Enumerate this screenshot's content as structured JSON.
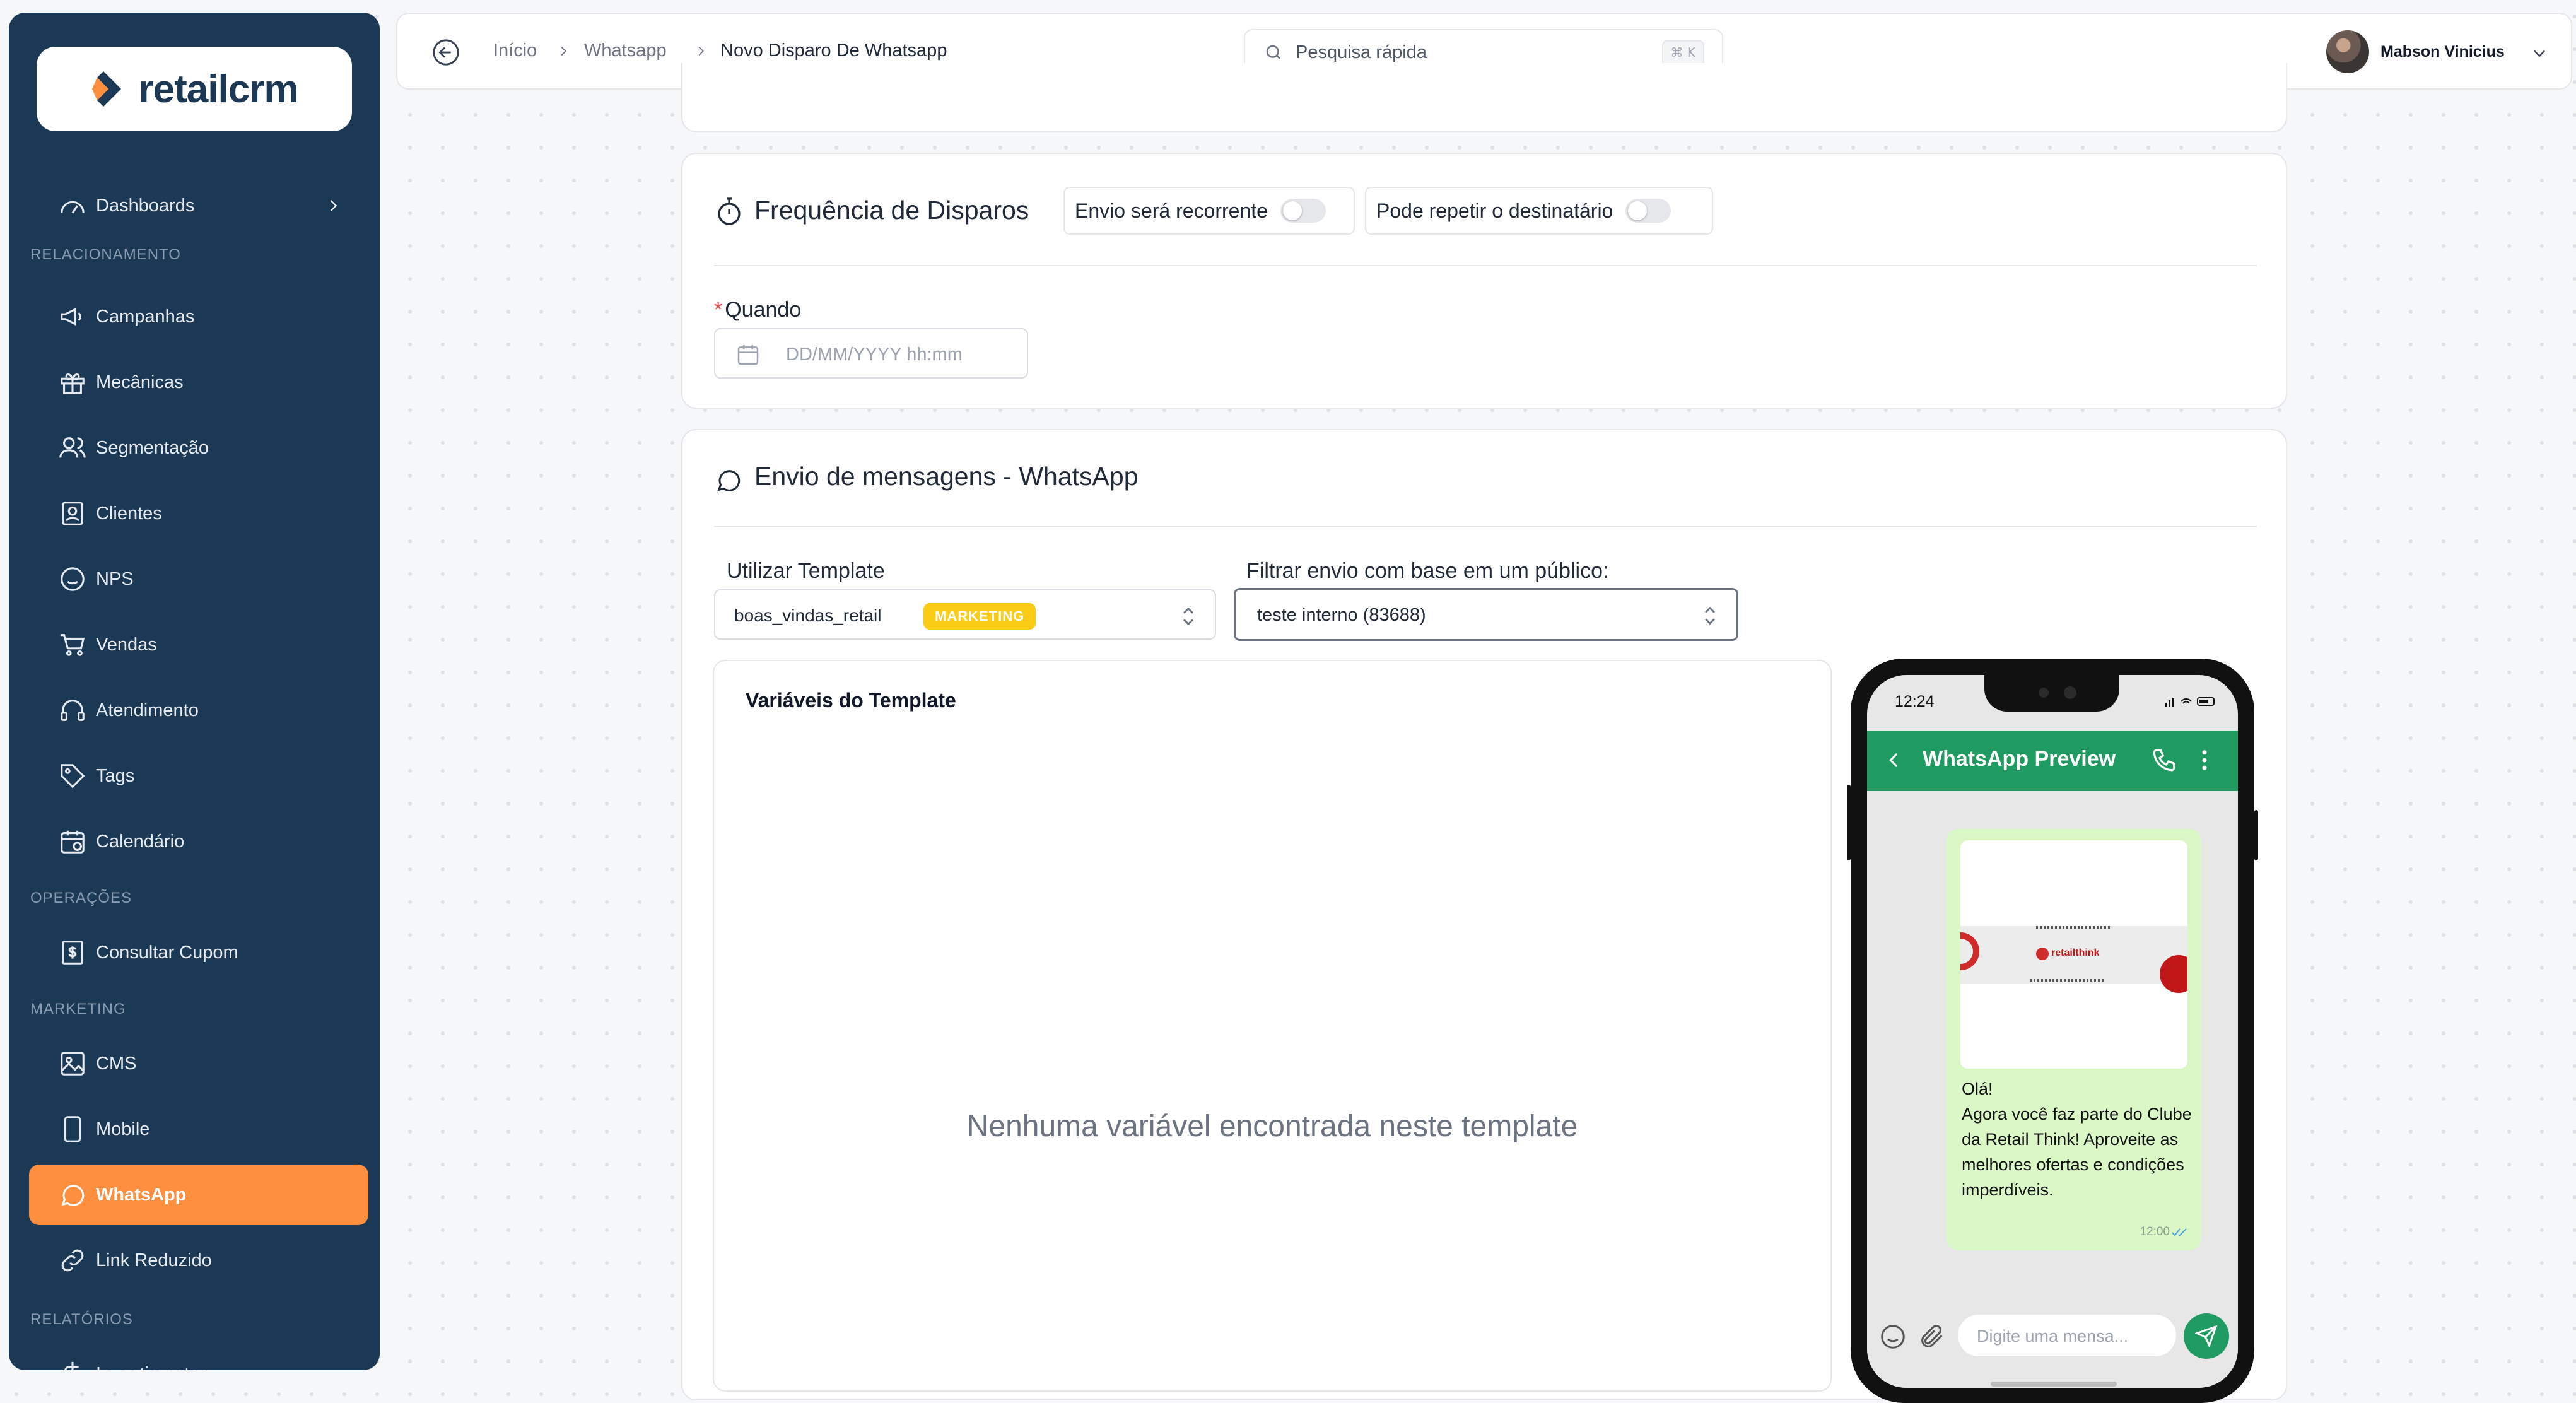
{
  "sidebar": {
    "logo_text": "retailcrm",
    "sections": {
      "relacionamento": "RELACIONAMENTO",
      "operacoes": "OPERAÇÕES",
      "marketing": "MARKETING",
      "relatorios": "RELATÓRIOS"
    },
    "items": {
      "dashboards": "Dashboards",
      "campanhas": "Campanhas",
      "mecanicas": "Mecânicas",
      "segmentacao": "Segmentação",
      "clientes": "Clientes",
      "nps": "NPS",
      "vendas": "Vendas",
      "atendimento": "Atendimento",
      "tags": "Tags",
      "calendario": "Calendário",
      "consultar_cupom": "Consultar Cupom",
      "cms": "CMS",
      "mobile": "Mobile",
      "whatsapp": "WhatsApp",
      "link_reduzido": "Link Reduzido",
      "investimentos": "Investimentos"
    },
    "active_color": "#fd8f3f",
    "bg_color": "#1b3855"
  },
  "topbar": {
    "breadcrumb": [
      "Início",
      "Whatsapp",
      "Novo Disparo De Whatsapp"
    ],
    "search_placeholder": "Pesquisa rápida",
    "search_shortcut": "⌘ K",
    "user_name": "Mabson Vinicius"
  },
  "frequencia": {
    "title": "Frequência de Disparos",
    "toggle_recorrente": "Envio será recorrente",
    "toggle_repetir": "Pode repetir o destinatário",
    "quando_label": "Quando",
    "quando_placeholder": "DD/MM/YYYY hh:mm"
  },
  "envio": {
    "title": "Envio de mensagens - WhatsApp",
    "template_label": "Utilizar Template",
    "template_value": "boas_vindas_retail",
    "template_badge": "MARKETING",
    "publico_label": "Filtrar envio com base em um público:",
    "publico_value": "teste interno (83688)",
    "vars_title": "Variáveis do Template",
    "vars_empty": "Nenhuma variável encontrada neste template"
  },
  "preview": {
    "status_time": "12:24",
    "header_title": "WhatsApp Preview",
    "banner_text": "retailthink",
    "message": "Olá!\nAgora você faz parte do Clube da Retail Think! Aproveite as melhores ofertas e condições imperdíveis.",
    "message_time": "12:00",
    "input_placeholder": "Digite uma mensa...",
    "accent_color": "#1f9a61"
  }
}
